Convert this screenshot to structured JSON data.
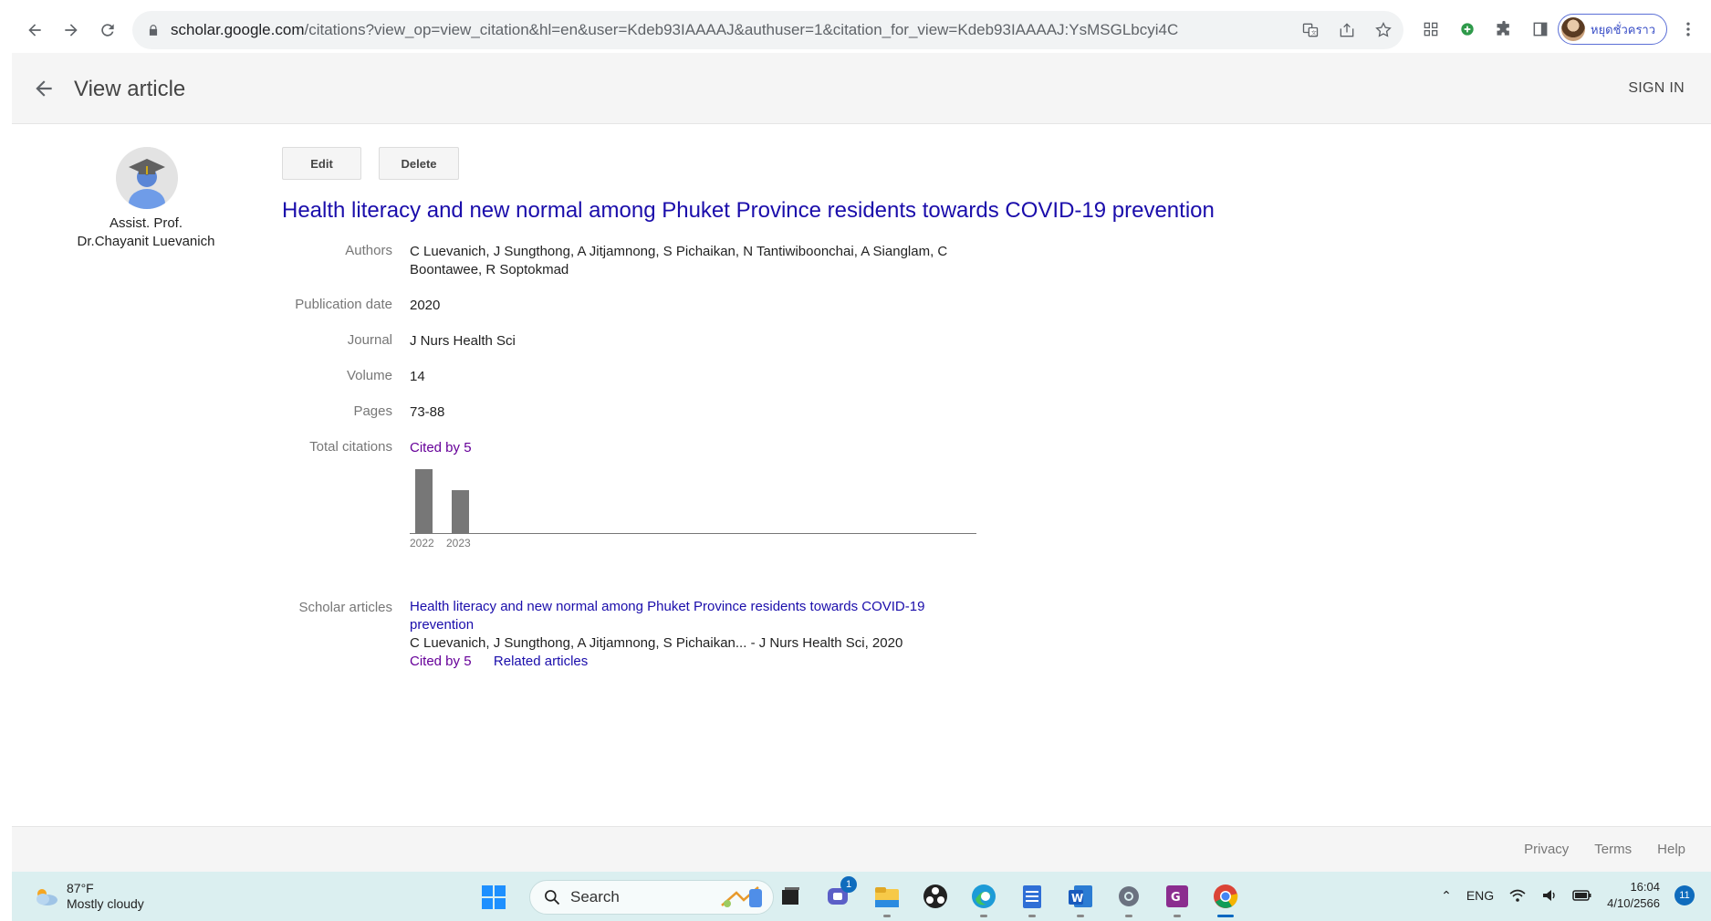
{
  "browser": {
    "url_host": "scholar.google.com",
    "url_path": "/citations?view_op=view_citation&hl=en&user=Kdeb93IAAAAJ&authuser=1&citation_for_view=Kdeb93IAAAAJ:YsMSGLbcyi4C",
    "profile_name": "หยุดชั่วคราว"
  },
  "header": {
    "title": "View article",
    "sign_in": "SIGN IN"
  },
  "profile": {
    "line1": "Assist. Prof.",
    "line2": "Dr.Chayanit Luevanich"
  },
  "actions": {
    "edit": "Edit",
    "delete": "Delete"
  },
  "article": {
    "title": "Health literacy and new normal among Phuket Province residents towards COVID-19 prevention",
    "fields": {
      "authors_label": "Authors",
      "authors_line1": "C Luevanich, J Sungthong, A Jitjamnong, S Pichaikan, N Tantiwiboonchai, A Sianglam, C",
      "authors_line2": "Boontawee, R Soptokmad",
      "pubdate_label": "Publication date",
      "pubdate": "2020",
      "journal_label": "Journal",
      "journal": "J Nurs Health Sci",
      "volume_label": "Volume",
      "volume": "14",
      "pages_label": "Pages",
      "pages": "73-88",
      "citations_label": "Total citations",
      "cited_by": "Cited by 5",
      "scholar_label": "Scholar articles"
    }
  },
  "chart_data": {
    "type": "bar",
    "categories": [
      "2022",
      "2023"
    ],
    "values": [
      3,
      2
    ],
    "ylim": [
      0,
      3
    ]
  },
  "scholar_article": {
    "title_line1": "Health literacy and new normal among Phuket Province residents towards COVID-19",
    "title_line2": "prevention",
    "meta": "C Luevanich, J Sungthong, A Jitjamnong, S Pichaikan... - J Nurs Health Sci, 2020",
    "cited_by": "Cited by 5",
    "related": "Related articles"
  },
  "footer": {
    "privacy": "Privacy",
    "terms": "Terms",
    "help": "Help"
  },
  "taskbar": {
    "temp": "87°F",
    "weather": "Mostly cloudy",
    "search": "Search",
    "chat_badge": "1",
    "lang": "ENG",
    "time": "16:04",
    "date": "4/10/2566",
    "notifications": "11"
  }
}
